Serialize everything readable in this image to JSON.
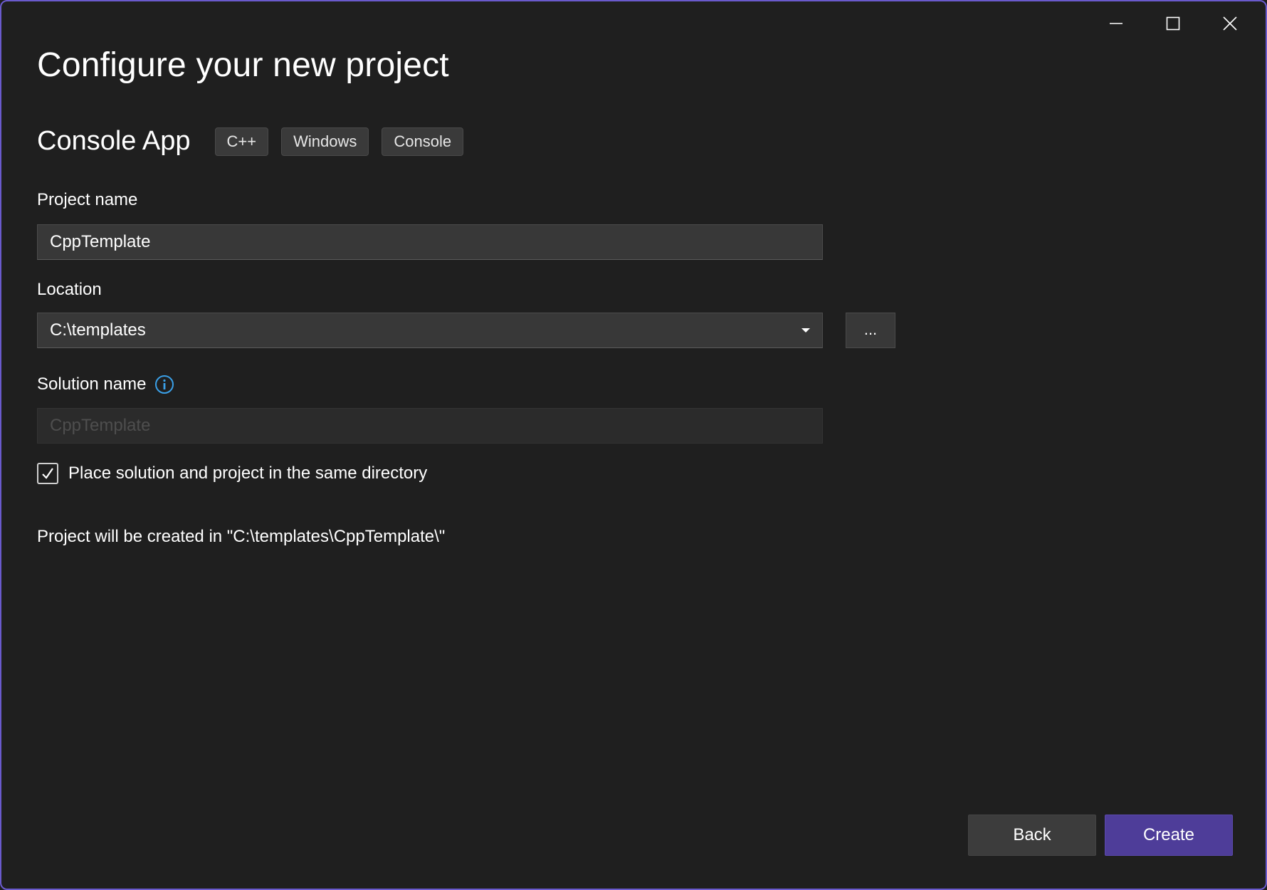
{
  "window": {
    "controls": {
      "minimize": "minimize-icon",
      "maximize": "maximize-icon",
      "close": "close-icon"
    }
  },
  "page": {
    "title": "Configure your new project"
  },
  "template": {
    "name": "Console App",
    "tags": [
      "C++",
      "Windows",
      "Console"
    ]
  },
  "project_name": {
    "label": "Project name",
    "value": "CppTemplate"
  },
  "location": {
    "label": "Location",
    "value": "C:\\templates",
    "browse_label": "..."
  },
  "solution_name": {
    "label": "Solution name",
    "placeholder": "CppTemplate",
    "info_icon": "info-icon"
  },
  "same_directory": {
    "label": "Place solution and project in the same directory",
    "checked": true
  },
  "created_path": "Project will be created in \"C:\\templates\\CppTemplate\\\"",
  "footer": {
    "back_label": "Back",
    "create_label": "Create"
  },
  "colors": {
    "background": "#1f1f1f",
    "accent": "#4e3d99",
    "border": "#6a5acd",
    "info": "#3aa0e8"
  }
}
